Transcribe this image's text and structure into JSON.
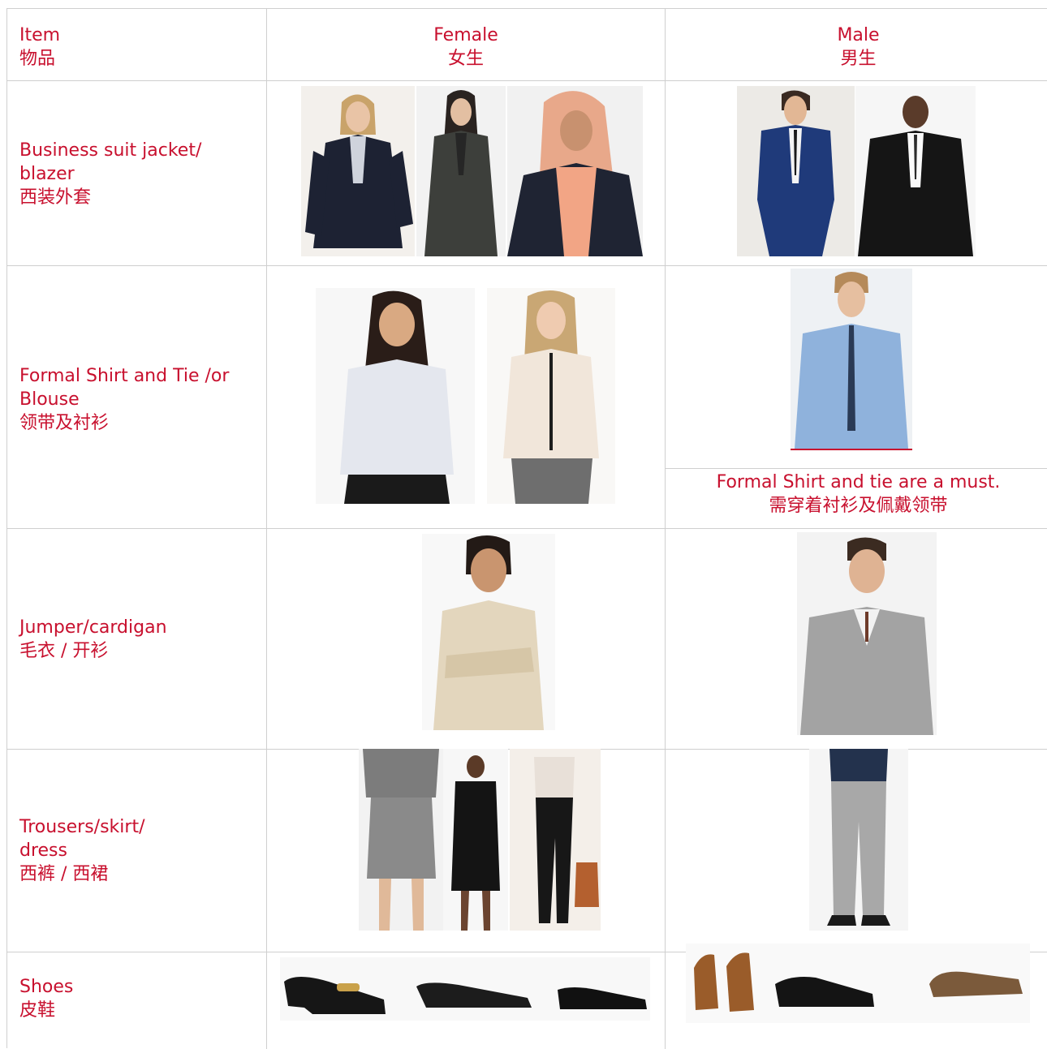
{
  "header": {
    "item": [
      "Item",
      "物品"
    ],
    "female": [
      "Female",
      "女生"
    ],
    "male": [
      "Male",
      "男生"
    ]
  },
  "rows": {
    "suit": {
      "label": [
        "Business suit jacket/",
        "blazer",
        "西装外套"
      ]
    },
    "shirt": {
      "label": [
        "Formal Shirt and Tie /or",
        "Blouse",
        "领带及衬衫"
      ],
      "male_note": [
        "Formal Shirt and tie are a must.",
        "需穿着衬衫及佩戴领带"
      ]
    },
    "jumper": {
      "label": [
        "Jumper/cardigan",
        "毛衣 / 开衫"
      ]
    },
    "trousers": {
      "label": [
        "Trousers/skirt/",
        "dress",
        "西裤 / 西裙"
      ]
    },
    "shoes": {
      "label": [
        "Shoes",
        "皮鞋"
      ]
    }
  },
  "colors": {
    "text_accent": "#c8102e",
    "grid_line": "#cfcfcf"
  }
}
